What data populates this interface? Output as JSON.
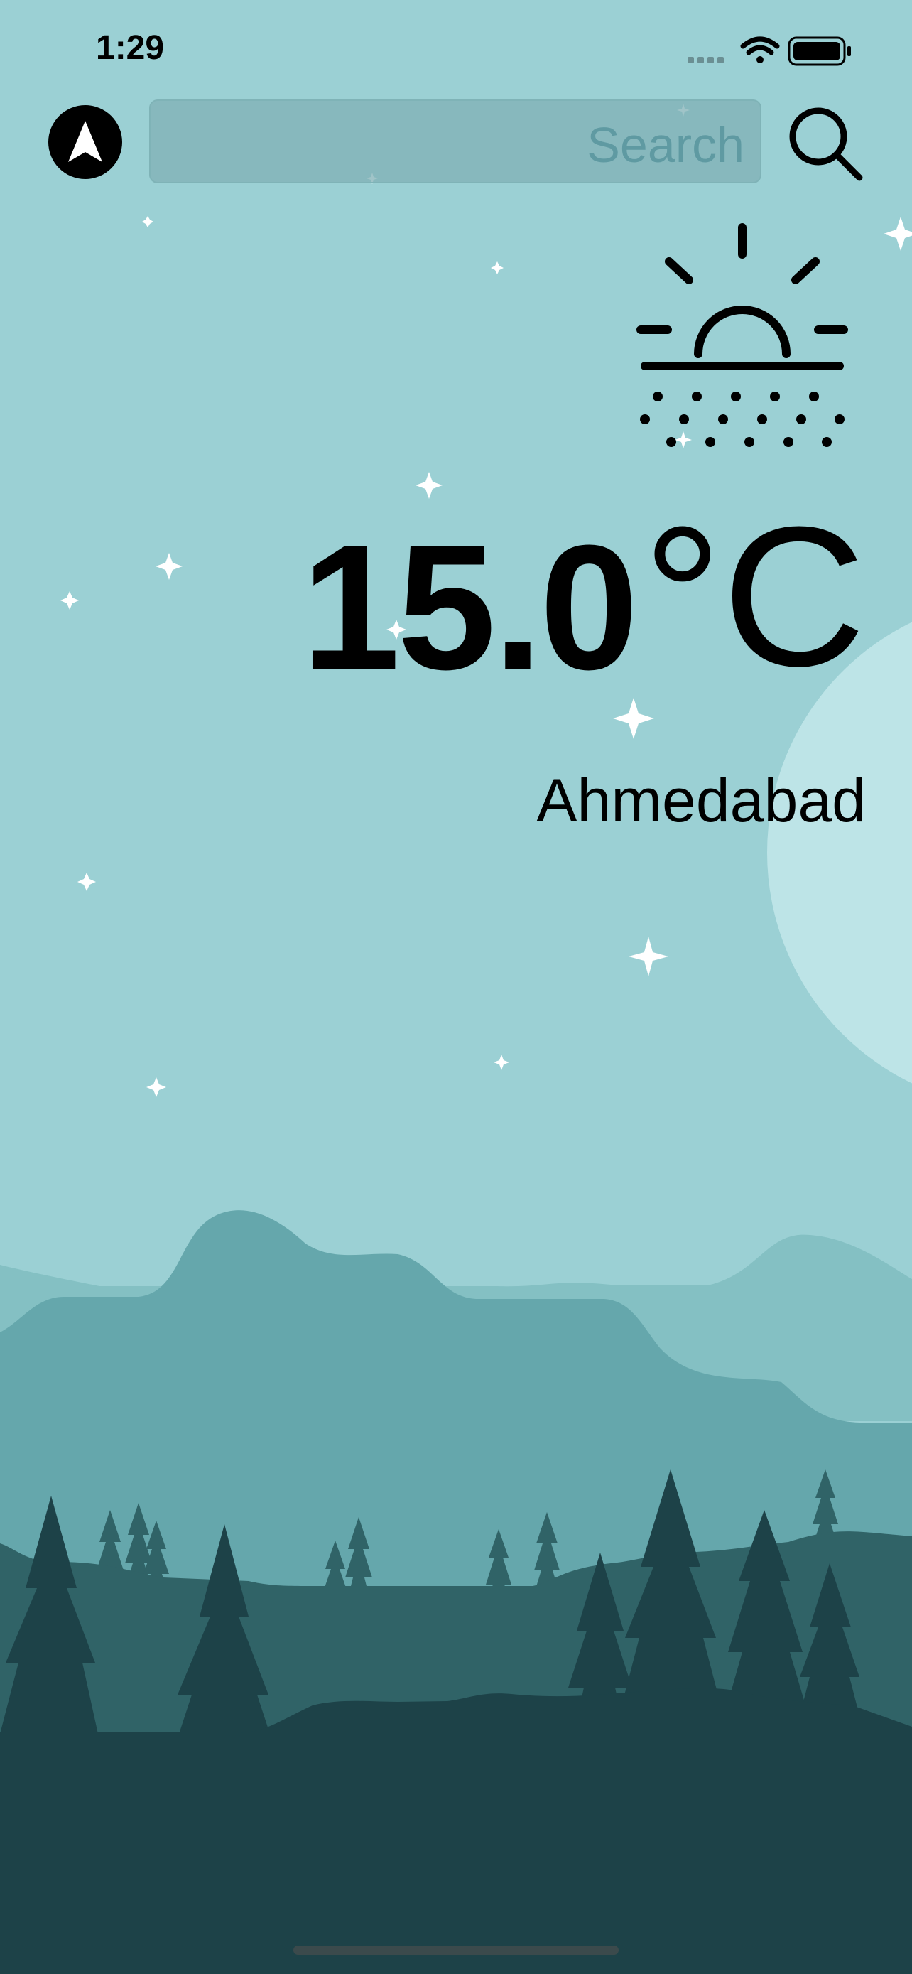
{
  "status_bar": {
    "time": "1:29",
    "icons": [
      "cellular-signal-icon",
      "wifi-icon",
      "battery-icon"
    ]
  },
  "header": {
    "location_button_icon": "navigation-arrow-icon",
    "search": {
      "placeholder": "Search",
      "value": ""
    },
    "search_button_icon": "magnifying-glass-icon"
  },
  "weather": {
    "condition_icon": "sunrise-fog-icon",
    "temperature": "15.0",
    "unit": "°C",
    "city": "Ahmedabad"
  },
  "theme": {
    "sky": "#9bd0d4",
    "moon": "#bde4e7",
    "far_hills": "#84c0c3",
    "mid_hills": "#65a7ac",
    "near_hills": "#306367",
    "foreground": "#1d4248",
    "star": "#ffffff"
  }
}
